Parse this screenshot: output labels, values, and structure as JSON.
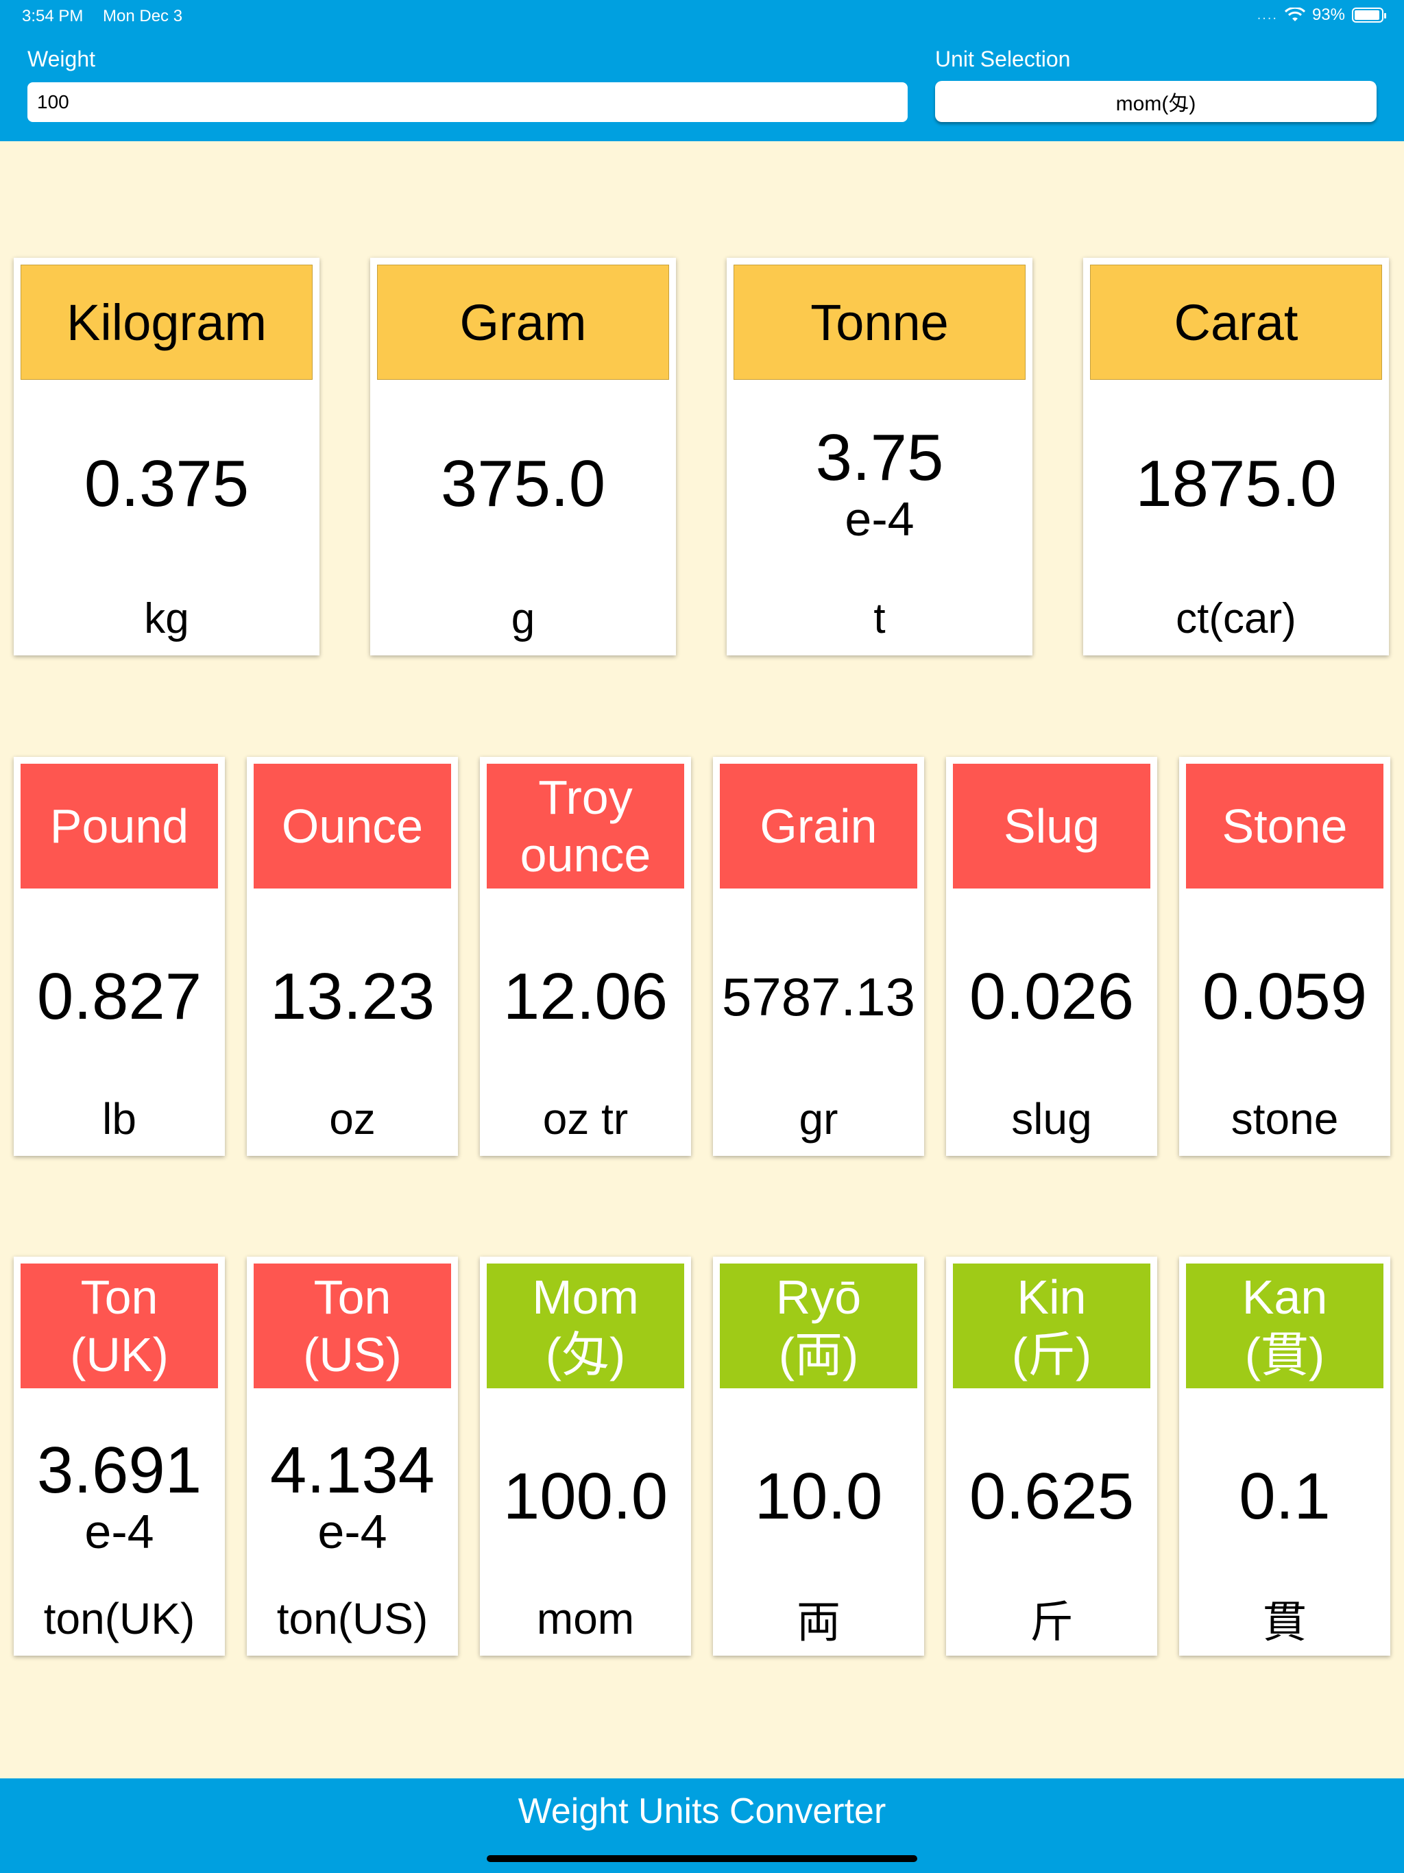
{
  "status_bar": {
    "time": "3:54 PM",
    "date": "Mon Dec 3",
    "signal_dots": "....",
    "battery": "93%"
  },
  "header": {
    "weight_label": "Weight",
    "weight_value": "100",
    "unit_label": "Unit Selection",
    "unit_value": "mom(匁)"
  },
  "colors": {
    "header": "#00a0e0",
    "metric": "#fcc94d",
    "imperial": "#fe5650",
    "japanese": "#9fcb17",
    "background": "#fef6d9"
  },
  "row1": [
    {
      "name": "Kilogram",
      "value": "0.375",
      "exp": "",
      "unit": "kg"
    },
    {
      "name": "Gram",
      "value": "375.0",
      "exp": "",
      "unit": "g"
    },
    {
      "name": "Tonne",
      "value": "3.75",
      "exp": "e-4",
      "unit": "t"
    },
    {
      "name": "Carat",
      "value": "1875.0",
      "exp": "",
      "unit": "ct(car)"
    }
  ],
  "row2": [
    {
      "name": "Pound",
      "value": "0.827",
      "exp": "",
      "unit": "lb"
    },
    {
      "name": "Ounce",
      "value": "13.23",
      "exp": "",
      "unit": "oz"
    },
    {
      "name": "Troy ounce",
      "value": "12.06",
      "exp": "",
      "unit": "oz tr"
    },
    {
      "name": "Grain",
      "value": "5787.13",
      "exp": "",
      "unit": "gr"
    },
    {
      "name": "Slug",
      "value": "0.026",
      "exp": "",
      "unit": "slug"
    },
    {
      "name": "Stone",
      "value": "0.059",
      "exp": "",
      "unit": "stone"
    }
  ],
  "row3": [
    {
      "name": "Ton (UK)",
      "value": "3.691",
      "exp": "e-4",
      "unit": "ton(UK)"
    },
    {
      "name": "Ton (US)",
      "value": "4.134",
      "exp": "e-4",
      "unit": "ton(US)"
    },
    {
      "name": "Mom (匁)",
      "value": "100.0",
      "exp": "",
      "unit": "mom"
    },
    {
      "name": "Ryō (両)",
      "value": "10.0",
      "exp": "",
      "unit": "両"
    },
    {
      "name": "Kin (斤)",
      "value": "0.625",
      "exp": "",
      "unit": "斤"
    },
    {
      "name": "Kan (貫)",
      "value": "0.1",
      "exp": "",
      "unit": "貫"
    }
  ],
  "footer": {
    "title": "Weight Units Converter"
  }
}
